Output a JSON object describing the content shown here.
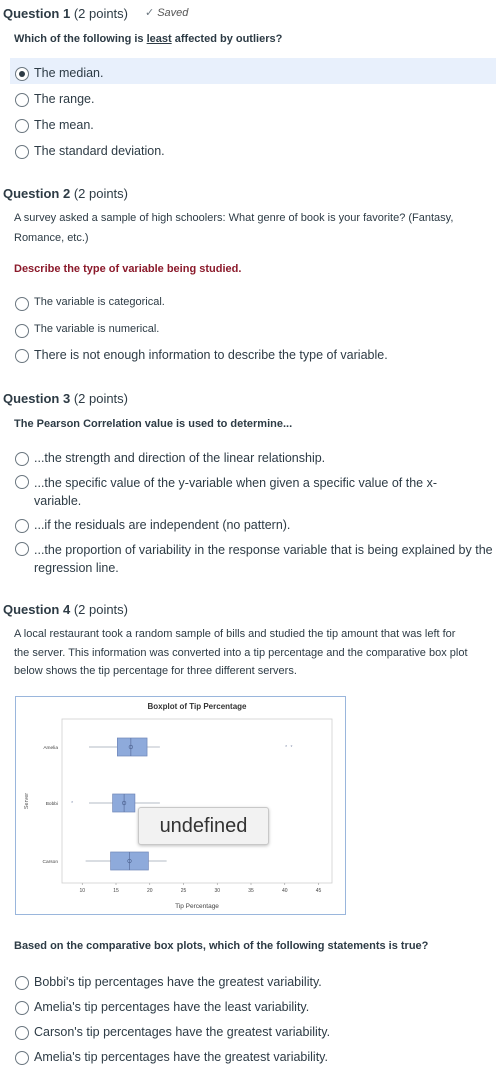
{
  "q1": {
    "number_label": "Question 1",
    "points": "(2 points)",
    "saved": "Saved",
    "prompt_before": "Which of the following is ",
    "prompt_underlined": "least",
    "prompt_after": " affected by outliers?",
    "options": [
      "The median.",
      "The range.",
      "The mean.",
      "The standard deviation."
    ],
    "selected_index": 0
  },
  "q2": {
    "number_label": "Question 2",
    "points": "(2 points)",
    "stem_line1": "A survey asked a sample of high schoolers: What genre of book is your favorite? (Fantasy,",
    "stem_line2": "Romance, etc.)",
    "prompt": "Describe the type of variable being studied.",
    "options": [
      "The variable is categorical.",
      "The variable is numerical.",
      "There is not enough information to describe the type of variable."
    ]
  },
  "q3": {
    "number_label": "Question 3",
    "points": "(2 points)",
    "prompt": "The Pearson Correlation value is used to determine...",
    "options": [
      "...the strength and direction of the linear relationship.",
      "...the specific value of the y-variable when given a specific value of the x-variable.",
      "...if the residuals are independent (no pattern).",
      "...the proportion of variability in the response variable that is being explained by the regression line."
    ]
  },
  "q4": {
    "number_label": "Question 4",
    "points": "(2 points)",
    "stem_line1": "A local restaurant took a random sample of bills and studied the tip amount that was left for",
    "stem_line2": "the server. This information was converted into a tip percentage and the comparative box plot",
    "stem_line3": "below shows the tip percentage for three different servers.",
    "prompt": "Based on the comparative box plots, which of the following statements is true?",
    "options": [
      "Bobbi's tip percentages have the greatest variability.",
      "Amelia's tip percentages have the least variability.",
      "Carson's tip percentages have the greatest variability.",
      "Amelia's tip percentages have the greatest variability."
    ],
    "image_overlay_text": "undefined"
  },
  "chart_data": {
    "type": "boxplot",
    "title": "Boxplot of Tip Percentage",
    "xlabel": "Tip Percentage",
    "ylabel": "Server",
    "xlim": [
      7,
      47
    ],
    "xticks": [
      10,
      15,
      20,
      25,
      30,
      35,
      40,
      45
    ],
    "categories": [
      "Amelia",
      "Bobbi",
      "Carson"
    ],
    "boxes": [
      {
        "name": "Amelia",
        "whisker_low": 11,
        "q1": 15.2,
        "median": 17.2,
        "mean": 17.2,
        "q3": 19.6,
        "whisker_high": 21.5,
        "outliers": [
          40.2,
          41
        ]
      },
      {
        "name": "Bobbi",
        "whisker_low": 11,
        "q1": 14.5,
        "median": 16.2,
        "mean": 16.2,
        "q3": 17.8,
        "whisker_high": 21.5,
        "outliers": [
          8.5
        ]
      },
      {
        "name": "Carson",
        "whisker_low": 10.5,
        "q1": 14.2,
        "median": 17.0,
        "mean": 17.0,
        "q3": 19.8,
        "whisker_high": 22.5,
        "outliers": []
      }
    ],
    "box_color": "#8eaadb",
    "grid": false
  }
}
